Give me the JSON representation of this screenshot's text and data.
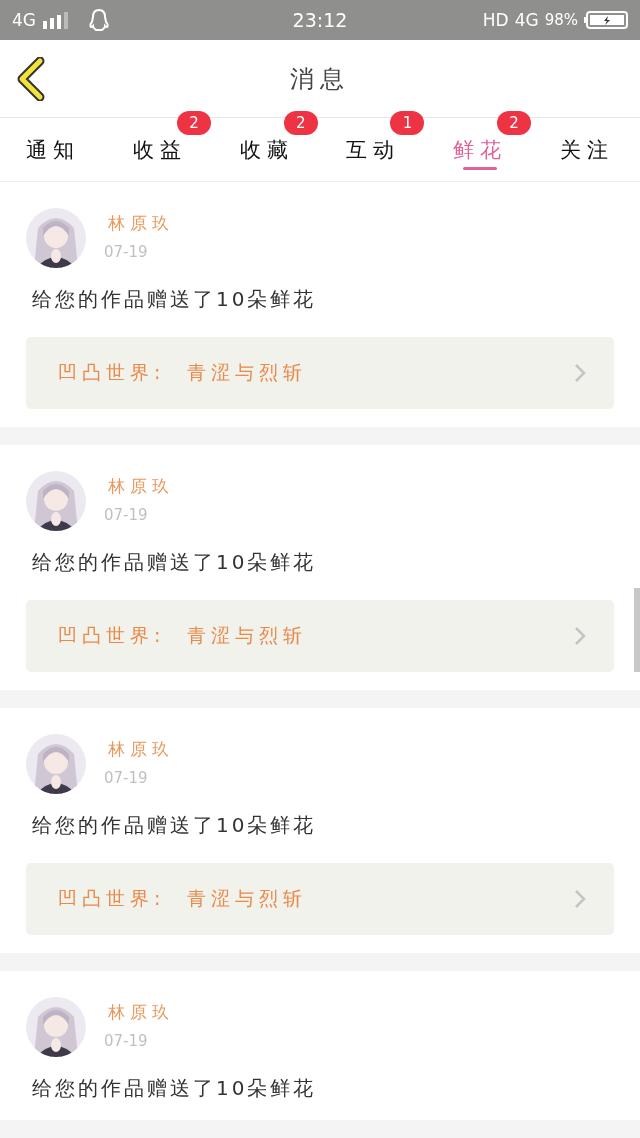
{
  "status_bar": {
    "network_left": "4G",
    "time": "23:12",
    "hd": "HD",
    "network_right": "4G",
    "battery": "98%"
  },
  "header": {
    "title": "消息"
  },
  "tabs": [
    {
      "label": "通知",
      "selected": false
    },
    {
      "label": "收益",
      "selected": false,
      "badge": "2"
    },
    {
      "label": "收藏",
      "selected": false,
      "badge": "2"
    },
    {
      "label": "互动",
      "selected": false,
      "badge": "1"
    },
    {
      "label": "鲜花",
      "selected": true,
      "badge": "2"
    },
    {
      "label": "关注",
      "selected": false
    }
  ],
  "messages": [
    {
      "name": "林原玖",
      "date": "07-19",
      "text": "给您的作品赠送了10朵鲜花",
      "link": "凹凸世界:  青涩与烈斩"
    },
    {
      "name": "林原玖",
      "date": "07-19",
      "text": "给您的作品赠送了10朵鲜花",
      "link": "凹凸世界:  青涩与烈斩"
    },
    {
      "name": "林原玖",
      "date": "07-19",
      "text": "给您的作品赠送了10朵鲜花",
      "link": "凹凸世界:  青涩与烈斩"
    },
    {
      "name": "林原玖",
      "date": "07-19",
      "text": "给您的作品赠送了10朵鲜花"
    }
  ]
}
